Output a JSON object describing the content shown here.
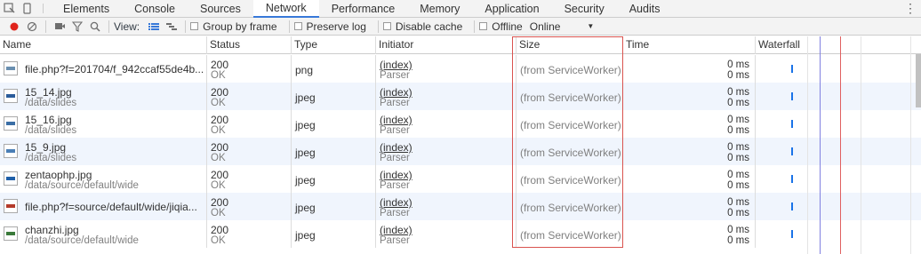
{
  "tabs": [
    "Elements",
    "Console",
    "Sources",
    "Network",
    "Performance",
    "Memory",
    "Application",
    "Security",
    "Audits"
  ],
  "active_tab_index": 3,
  "toolbar": {
    "view_label": "View:",
    "group_by_frame": "Group by frame",
    "preserve_log": "Preserve log",
    "disable_cache": "Disable cache",
    "offline": "Offline",
    "throttle": "Online"
  },
  "columns": {
    "name": "Name",
    "status": "Status",
    "type": "Type",
    "initiator": "Initiator",
    "size": "Size",
    "time": "Time",
    "waterfall": "Waterfall"
  },
  "rows": [
    {
      "name": "file.php?f=201704/f_942ccaf55de4b...",
      "path": "",
      "status": "200",
      "status_text": "OK",
      "type": "png",
      "initiator": "(index)",
      "initiator_sub": "Parser",
      "size": "(from ServiceWorker)",
      "time1": "0 ms",
      "time2": "0 ms",
      "thumb_color": "#6a8fb0"
    },
    {
      "name": "15_14.jpg",
      "path": "/data/slides",
      "status": "200",
      "status_text": "OK",
      "type": "jpeg",
      "initiator": "(index)",
      "initiator_sub": "Parser",
      "size": "(from ServiceWorker)",
      "time1": "0 ms",
      "time2": "0 ms",
      "thumb_color": "#2a5b9a"
    },
    {
      "name": "15_16.jpg",
      "path": "/data/slides",
      "status": "200",
      "status_text": "OK",
      "type": "jpeg",
      "initiator": "(index)",
      "initiator_sub": "Parser",
      "size": "(from ServiceWorker)",
      "time1": "0 ms",
      "time2": "0 ms",
      "thumb_color": "#3b6ea5"
    },
    {
      "name": "15_9.jpg",
      "path": "/data/slides",
      "status": "200",
      "status_text": "OK",
      "type": "jpeg",
      "initiator": "(index)",
      "initiator_sub": "Parser",
      "size": "(from ServiceWorker)",
      "time1": "0 ms",
      "time2": "0 ms",
      "thumb_color": "#4a7fb6"
    },
    {
      "name": "zentaophp.jpg",
      "path": "/data/source/default/wide",
      "status": "200",
      "status_text": "OK",
      "type": "jpeg",
      "initiator": "(index)",
      "initiator_sub": "Parser",
      "size": "(from ServiceWorker)",
      "time1": "0 ms",
      "time2": "0 ms",
      "thumb_color": "#1f5fa8"
    },
    {
      "name": "file.php?f=source/default/wide/jiqia...",
      "path": "",
      "status": "200",
      "status_text": "OK",
      "type": "jpeg",
      "initiator": "(index)",
      "initiator_sub": "Parser",
      "size": "(from ServiceWorker)",
      "time1": "0 ms",
      "time2": "0 ms",
      "thumb_color": "#b33a2a"
    },
    {
      "name": "chanzhi.jpg",
      "path": "/data/source/default/wide",
      "status": "200",
      "status_text": "OK",
      "type": "jpeg",
      "initiator": "(index)",
      "initiator_sub": "Parser",
      "size": "(from ServiceWorker)",
      "time1": "0 ms",
      "time2": "0 ms",
      "thumb_color": "#3a7a3a"
    }
  ],
  "colors": {
    "record": "#e0231b",
    "highlight": "#d9534f",
    "active_tab": "#3879d9",
    "waterfall_blue": "#1a73e8",
    "waterfall_red": "#e06060"
  }
}
